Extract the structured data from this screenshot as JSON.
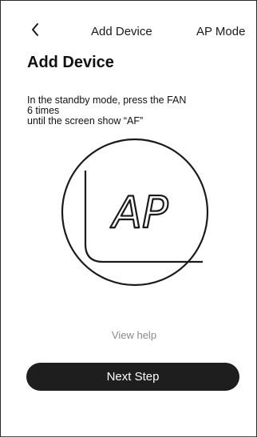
{
  "header": {
    "back_icon": "chevron-left-icon",
    "title": "Add Device",
    "mode_label": "AP Mode"
  },
  "main": {
    "heading": "Add Device",
    "instruction_lines": [
      "In the standby mode, press the FAN",
      "6 times",
      "until the screen show “AF”"
    ],
    "display_text": "AP",
    "view_help": "View help",
    "next_button": "Next Step"
  },
  "colors": {
    "button_bg": "#1e1e1e",
    "button_text": "#ffffff",
    "help_text": "#8a8a8a",
    "text": "#1a1a1a"
  }
}
